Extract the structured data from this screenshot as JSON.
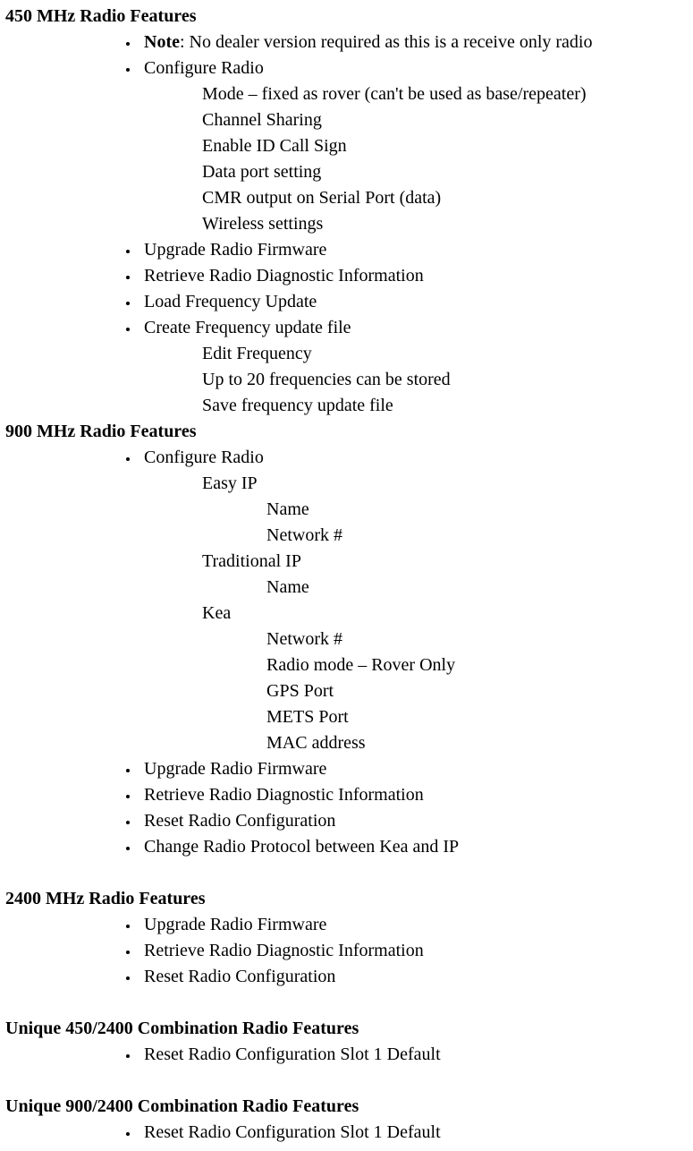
{
  "sections": {
    "s450": {
      "heading": "450 MHz Radio Features",
      "note_label": "Note",
      "note_text": ": No dealer version required as this is a receive only radio",
      "configure_radio": "Configure Radio",
      "configure_sub": {
        "mode": "Mode – fixed as rover (can't be used as base/repeater)",
        "channel_sharing": "Channel Sharing",
        "enable_id": "Enable ID Call Sign",
        "data_port": "Data port setting",
        "cmr_output": "CMR output on Serial Port (data)",
        "wireless": "Wireless settings"
      },
      "upgrade_firmware": "Upgrade Radio Firmware",
      "retrieve_diag": "Retrieve Radio Diagnostic Information",
      "load_freq": "Load Frequency Update",
      "create_freq": "Create Frequency update file",
      "create_freq_sub": {
        "edit": "Edit Frequency",
        "upto20": "Up to 20 frequencies can be stored",
        "save": "Save frequency update file"
      }
    },
    "s900": {
      "heading": "900 MHz Radio Features",
      "configure_radio": "Configure Radio",
      "easy_ip": "Easy IP",
      "easy_ip_sub": {
        "name": "Name",
        "network": "Network #"
      },
      "traditional_ip": "Traditional IP",
      "traditional_ip_sub": {
        "name": "Name"
      },
      "kea": "Kea",
      "kea_sub": {
        "network": "Network #",
        "radio_mode": "Radio mode – Rover Only",
        "gps_port": "GPS Port",
        "mets_port": "METS Port",
        "mac": "MAC address"
      },
      "upgrade_firmware": "Upgrade Radio Firmware",
      "retrieve_diag": "Retrieve Radio Diagnostic Information",
      "reset_config": "Reset Radio Configuration",
      "change_protocol": "Change Radio Protocol between Kea and IP"
    },
    "s2400": {
      "heading": "2400 MHz Radio Features",
      "upgrade_firmware": "Upgrade Radio Firmware",
      "retrieve_diag": "Retrieve Radio Diagnostic Information",
      "reset_config": "Reset Radio Configuration"
    },
    "u450_2400": {
      "heading": "Unique 450/2400 Combination Radio Features",
      "reset_slot1": "Reset Radio Configuration Slot 1 Default"
    },
    "u900_2400": {
      "heading": "Unique 900/2400 Combination Radio Features",
      "reset_slot1": "Reset Radio Configuration Slot 1 Default"
    }
  }
}
